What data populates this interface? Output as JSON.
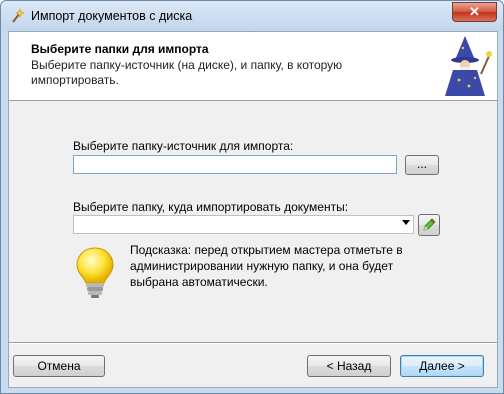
{
  "window": {
    "title": "Импорт документов с диска",
    "close_label": "✕"
  },
  "header": {
    "title": "Выберите папки для импорта",
    "subtitle": "Выберите папку-источник (на диске), и папку, в которую импортировать."
  },
  "source": {
    "label": "Выберите папку-источник для импорта:",
    "value": "",
    "browse_label": "..."
  },
  "target": {
    "label": "Выберите папку, куда импортировать документы:",
    "value": ""
  },
  "hint": {
    "text": "Подсказка: перед открытием мастера отметьте в администрировании нужную папку, и она будет выбрана автоматически."
  },
  "buttons": {
    "cancel": "Отмена",
    "back": "< Назад",
    "next": "Далее >"
  },
  "icons": {
    "title": "wand-icon",
    "header": "wizard-icon",
    "hint": "lightbulb-icon",
    "edit": "pencil-icon"
  },
  "colors": {
    "title_bar": "#c9dcee",
    "close_button": "#c2331c",
    "default_button_border": "#3c7fb1",
    "textbox_border": "#7ea6c8"
  }
}
